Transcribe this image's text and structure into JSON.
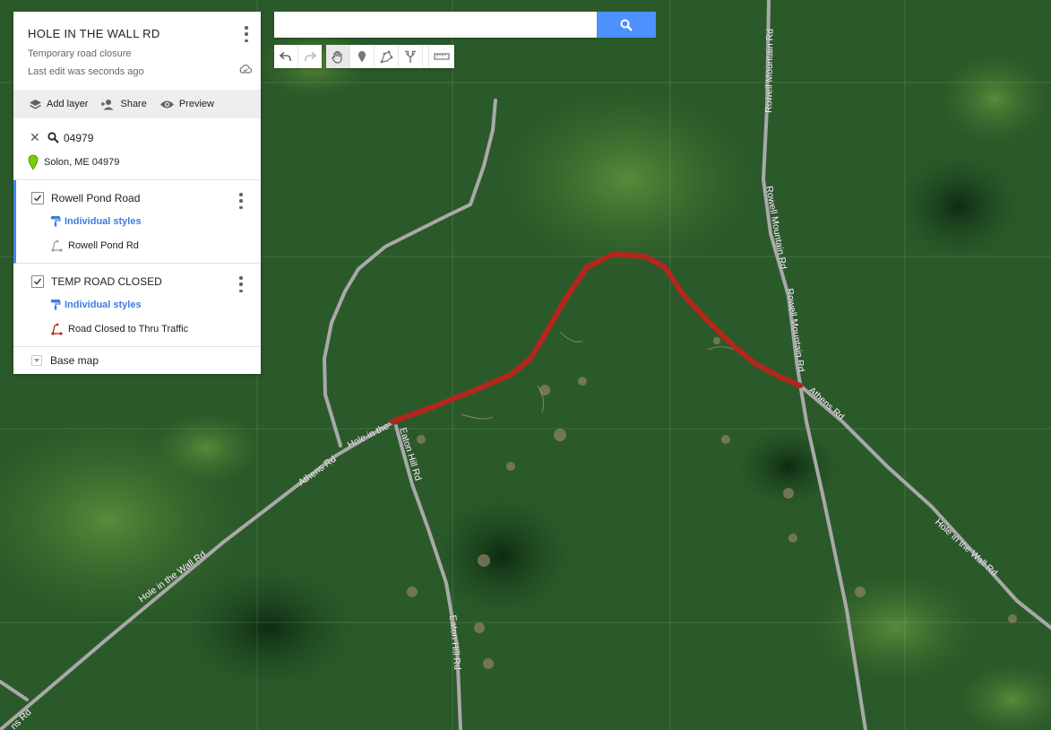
{
  "map": {
    "title": "HOLE IN THE WALL RD",
    "description": "Temporary road closure",
    "last_edit": "Last edit was seconds ago"
  },
  "actions": {
    "add_layer": "Add layer",
    "share": "Share",
    "preview": "Preview"
  },
  "search": {
    "query": "04979",
    "result": "Solon, ME 04979",
    "box_value": "",
    "box_placeholder": ""
  },
  "layers": [
    {
      "name": "Rowell Pond Road",
      "checked": true,
      "style_label": "Individual styles",
      "items": [
        {
          "label": "Rowell Pond Rd",
          "icon": "line-icon"
        }
      ]
    },
    {
      "name": "TEMP ROAD CLOSED",
      "checked": true,
      "style_label": "Individual styles",
      "items": [
        {
          "label": "Road Closed to Thru Traffic",
          "icon": "line-icon",
          "color": "#b3261e"
        }
      ]
    }
  ],
  "base_map": "Base map",
  "toolbar": [
    "undo-icon",
    "redo-icon",
    "hand-icon",
    "marker-icon",
    "draw-line-icon",
    "directions-icon",
    "ruler-icon"
  ],
  "road_labels": {
    "athens_left": "Athens Rd",
    "hole_mid": "Hole in the",
    "hole_left": "Hole in the Wall Rd",
    "hole_right": "Hole in the Wall Rd",
    "eaton_top": "Eaton Hill Rd",
    "eaton_bottom": "Eaton Hill Rd",
    "rowell_top": "Rowell Mountain Rd",
    "rowell_mid": "Rowell Mountain Rd",
    "rowell_low": "Rowell Mountain Rd",
    "athens_right": "Athens Rd",
    "corner": "ns Rd"
  },
  "colors": {
    "closure_route": "#b3261e",
    "accent": "#4285f4",
    "search_button": "#4d90fe",
    "marker": "#7cd000"
  }
}
